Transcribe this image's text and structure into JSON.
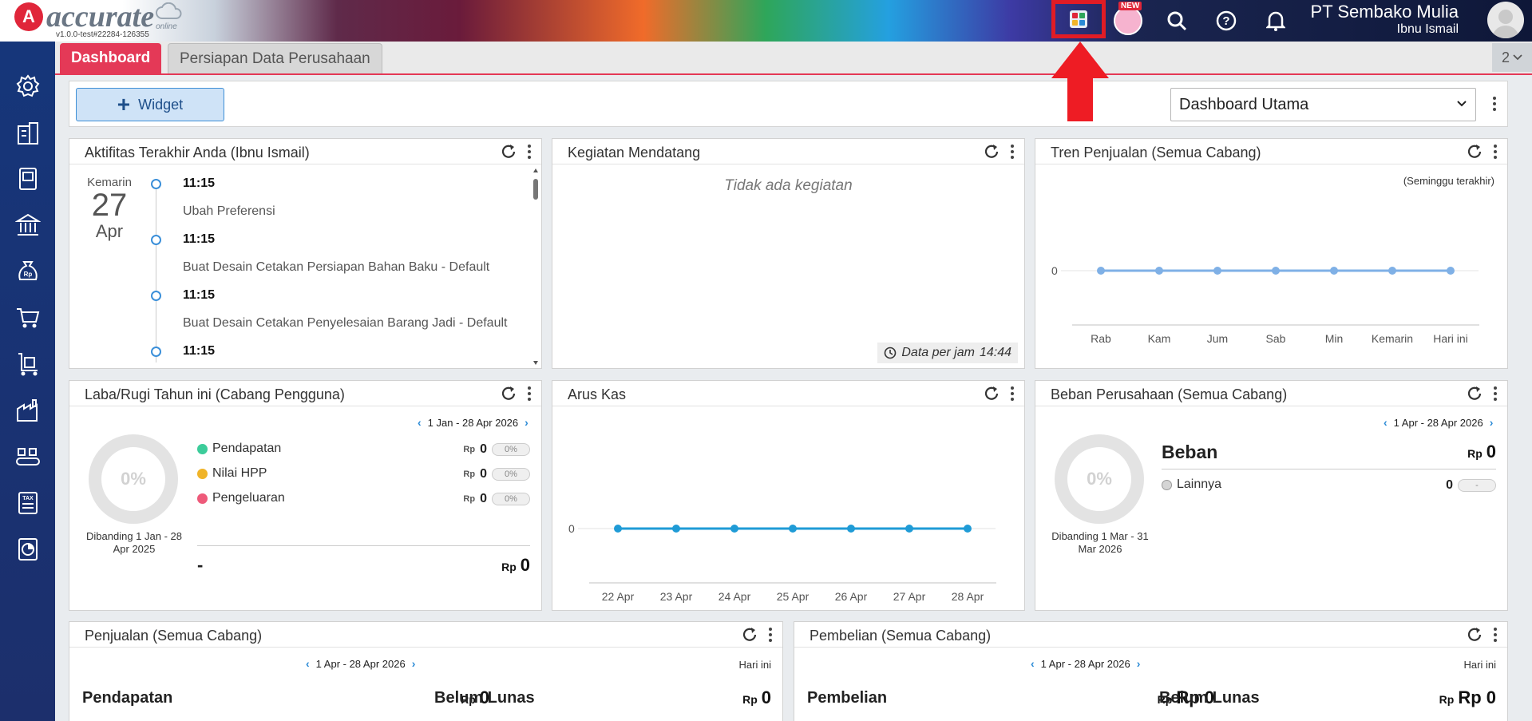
{
  "header": {
    "logo_letter": "A",
    "logo_word": "accurate",
    "logo_sub": "online",
    "version": "v1.0.0-test#22284-126355",
    "new_badge": "NEW",
    "company_name": "PT Sembako Mulia",
    "user_name": "Ibnu Ismail",
    "icons": [
      "apps-icon",
      "mascot-icon",
      "search-icon",
      "help-icon",
      "bell-icon",
      "avatar-icon"
    ]
  },
  "sidebar": {
    "icons": [
      "gear-icon",
      "building-icon",
      "ledger-book-icon",
      "bank-icon",
      "money-bag-icon",
      "cart-icon",
      "trolley-icon",
      "factory-icon",
      "conveyor-icon",
      "tax-icon",
      "report-icon"
    ]
  },
  "tabs": [
    {
      "label": "Dashboard"
    },
    {
      "label": "Persiapan Data Perusahaan"
    }
  ],
  "tab_count": "2",
  "toolbar": {
    "widget_label": "Widget",
    "dashboard_select": "Dashboard Utama"
  },
  "panels": {
    "activity": {
      "title": "Aktifitas Terakhir Anda (Ibnu Ismail)",
      "date_label": "Kemarin",
      "date_day": "27",
      "date_month": "Apr",
      "entries": [
        {
          "time": "11:15",
          "text": "Ubah Preferensi"
        },
        {
          "time": "11:15",
          "text": "Buat Desain Cetakan Persiapan Bahan Baku - Default"
        },
        {
          "time": "11:15",
          "text": "Buat Desain Cetakan Penyelesaian Barang Jadi - Default"
        },
        {
          "time": "11:15",
          "text": ""
        }
      ]
    },
    "upcoming": {
      "title": "Kegiatan Mendatang",
      "empty": "Tidak ada kegiatan",
      "footer": "Data per jam",
      "footer_time": "14:44"
    },
    "sales_trend": {
      "title": "Tren Penjualan (Semua Cabang)",
      "note": "(Seminggu terakhir)"
    },
    "profit_loss": {
      "title": "Laba/Rugi Tahun ini (Cabang Pengguna)",
      "range": "1 Jan - 28 Apr 2026",
      "ring": "0%",
      "compare": "Dibanding 1 Jan - 28 Apr 2025",
      "rows": [
        {
          "label": "Pendapatan",
          "rp": "Rp",
          "value": "0",
          "pct": "0%",
          "color": "#3ccc9a"
        },
        {
          "label": "Nilai HPP",
          "rp": "Rp",
          "value": "0",
          "pct": "0%",
          "color": "#f0b429"
        },
        {
          "label": "Pengeluaran",
          "rp": "Rp",
          "value": "0",
          "pct": "0%",
          "color": "#ee5a7a"
        }
      ],
      "total_label": "-",
      "total_rp": "Rp",
      "total_value": "0"
    },
    "cash_flow": {
      "title": "Arus Kas"
    },
    "expense": {
      "title": "Beban Perusahaan (Semua Cabang)",
      "range": "1 Apr - 28 Apr 2026",
      "ring": "0%",
      "compare": "Dibanding 1 Mar - 31 Mar 2026",
      "heading": "Beban",
      "heading_rp": "Rp",
      "heading_value": "0",
      "row_label": "Lainnya",
      "row_value": "0",
      "row_pct": "-"
    },
    "sales": {
      "title": "Penjualan (Semua Cabang)",
      "range": "1 Apr - 28 Apr 2026",
      "period": "Hari ini",
      "left_label": "Pendapatan",
      "left_rp": "Rp",
      "left_value": "0",
      "right_label": "Belum Lunas",
      "right_rp": "Rp",
      "right_value": "0"
    },
    "purchase": {
      "title": "Pembelian (Semua Cabang)",
      "range": "1 Apr - 28 Apr 2026",
      "period": "Hari ini",
      "left_label": "Pembelian",
      "left_rp": "Rp",
      "left_value": "Rp 0",
      "right_label": "Belum Lunas",
      "right_rp": "Rp",
      "right_value": "Rp 0"
    }
  },
  "chart_data": [
    {
      "type": "line",
      "categories": [
        "Rab",
        "Kam",
        "Jum",
        "Sab",
        "Min",
        "Kemarin",
        "Hari ini"
      ],
      "values": [
        0,
        0,
        0,
        0,
        0,
        0,
        0
      ],
      "ytick_labels": [
        "0"
      ],
      "color": "#7fb0e6"
    },
    {
      "type": "line",
      "categories": [
        "22 Apr",
        "23 Apr",
        "24 Apr",
        "25 Apr",
        "26 Apr",
        "27 Apr",
        "28 Apr"
      ],
      "values": [
        0,
        0,
        0,
        0,
        0,
        0,
        0
      ],
      "ytick_labels": [
        "0"
      ],
      "color": "#1f9bd6"
    }
  ],
  "colors": {
    "accent": "#e43957",
    "sidebar": "#1c2f6c",
    "highlight_box": "#e11c25",
    "arrow": "#ee1c24",
    "link": "#2a8ad6"
  }
}
